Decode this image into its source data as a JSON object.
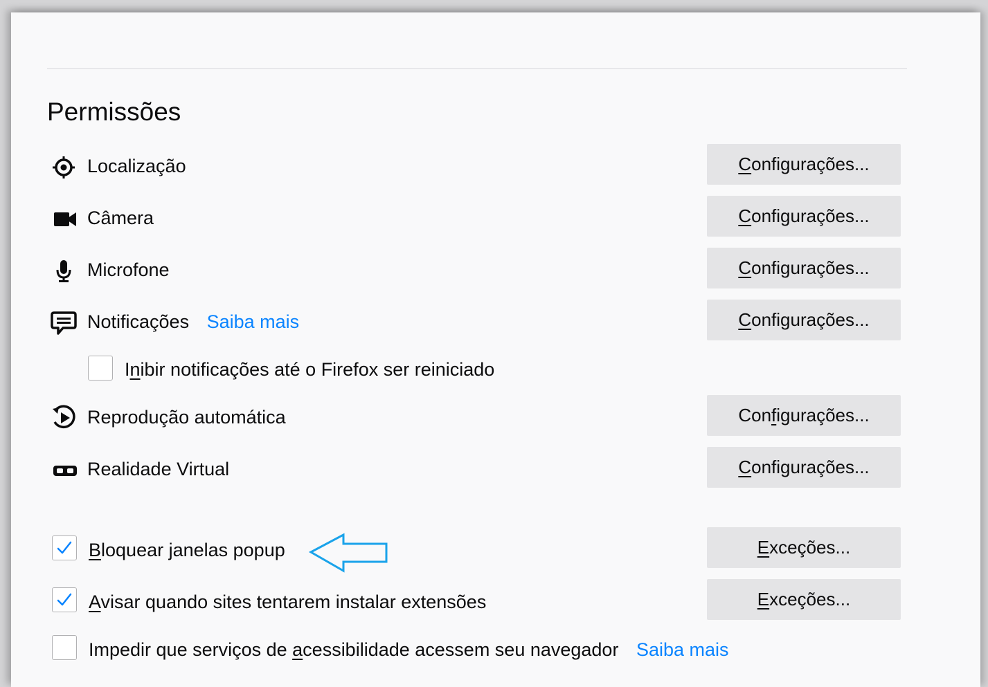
{
  "section": {
    "title": "Permissões"
  },
  "permissions": [
    {
      "icon": "location-icon",
      "label": "Localização",
      "button": "Configurações...",
      "button_accesskey_pre": "",
      "button_accesskey": "C",
      "button_accesskey_post": "onfigurações..."
    },
    {
      "icon": "camera-icon",
      "label": "Câmera",
      "button": "Configurações...",
      "button_accesskey_pre": "",
      "button_accesskey": "C",
      "button_accesskey_post": "onfigurações..."
    },
    {
      "icon": "microphone-icon",
      "label": "Microfone",
      "button": "Configurações...",
      "button_accesskey_pre": "",
      "button_accesskey": "C",
      "button_accesskey_post": "onfigurações..."
    },
    {
      "icon": "notifications-icon",
      "label": "Notificações",
      "link": "Saiba mais",
      "button": "Configurações...",
      "button_accesskey_pre": "",
      "button_accesskey": "C",
      "button_accesskey_post": "onfigurações..."
    },
    {
      "icon": "autoplay-icon",
      "label": "Reprodução automática",
      "button": "Configurações...",
      "button_accesskey_pre": "Con",
      "button_accesskey": "f",
      "button_accesskey_post": "igurações..."
    },
    {
      "icon": "vr-headset-icon",
      "label": "Realidade Virtual",
      "button": "Configurações...",
      "button_accesskey_pre": "",
      "button_accesskey": "C",
      "button_accesskey_post": "onfigurações..."
    }
  ],
  "pause_notifications": {
    "checked": false,
    "label_pre": "I",
    "label_key": "n",
    "label_post": "ibir notificações até o Firefox ser reiniciado"
  },
  "block_popups": {
    "checked": true,
    "label_key": "B",
    "label_post": "loquear janelas popup",
    "button_key": "E",
    "button_post": "xceções..."
  },
  "warn_addons": {
    "checked": true,
    "label_key": "A",
    "label_post": "visar quando sites tentarem instalar extensões",
    "button_key": "E",
    "button_post": "xceções..."
  },
  "block_accessibility": {
    "checked": false,
    "label_pre": "Impedir que serviços de ",
    "label_key": "a",
    "label_post": "cessibilidade acessem seu navegador",
    "link": "Saiba mais"
  },
  "colors": {
    "accent_link": "#0a84ff",
    "checkmark": "#0a84ff",
    "annotation_arrow": "#1aa3ea",
    "button_bg": "#e4e4e6"
  }
}
